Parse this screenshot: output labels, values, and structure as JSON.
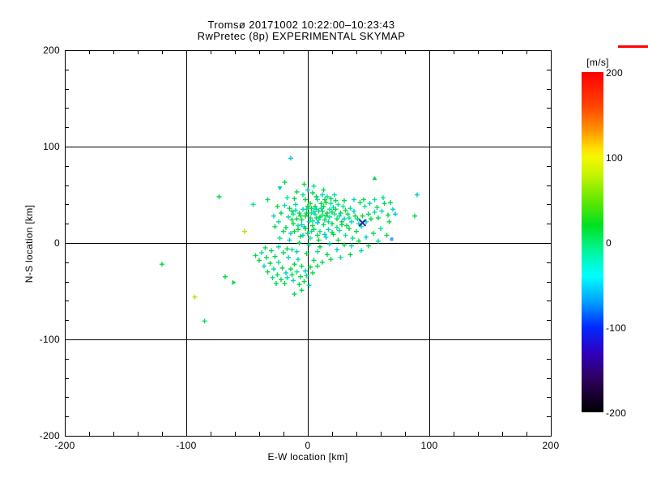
{
  "title": {
    "line1": "Tromsø 20171002 10:22:00–10:23:43",
    "line2": "RwPretec (8p) EXPERIMENTAL SKYMAP"
  },
  "chart_data": {
    "type": "scatter",
    "title": "Tromsø 20171002 10:22:00–10:23:43",
    "subtitle": "RwPretec (8p) EXPERIMENTAL SKYMAP",
    "xlabel": "E-W location [km]",
    "ylabel": "N-S location [km]",
    "xlim": [
      -200,
      200
    ],
    "ylim": [
      -200,
      200
    ],
    "xticks": [
      "-200",
      "-100",
      "0",
      "100",
      "200"
    ],
    "yticks": [
      "200",
      "100",
      "0",
      "-100",
      "-200"
    ],
    "xtick_values": [
      -200,
      -100,
      0,
      100,
      200
    ],
    "ytick_values": [
      200,
      100,
      0,
      -100,
      -200
    ],
    "gridlines_at": [
      -100,
      0,
      100
    ],
    "minor_tick_interval_km": 20,
    "grid": true,
    "legend_position": "none",
    "marker_default": "plus",
    "colorbar": {
      "label": "[m/s]",
      "lim": [
        -200,
        200
      ],
      "ticks": [
        "200",
        "100",
        "0",
        "-100",
        "-200"
      ],
      "tick_values": [
        200,
        100,
        0,
        -100,
        -200
      ],
      "colormap": "rainbow (red=+200, yellow=+100, green=0, cyan=-50, blue=-100, black=-200)"
    },
    "palette": [
      "#00d944",
      "#00e392",
      "#00d2bc",
      "#00c6e6",
      "#2ec232",
      "#b4e000",
      "#4a9aff",
      "#2525b0"
    ],
    "points": [
      [
        -2,
        28,
        0
      ],
      [
        3,
        31,
        1
      ],
      [
        7,
        26,
        0
      ],
      [
        1,
        22,
        2
      ],
      [
        9,
        33,
        0
      ],
      [
        12,
        29,
        1
      ],
      [
        -5,
        24,
        0
      ],
      [
        4,
        18,
        0
      ],
      [
        8,
        21,
        3
      ],
      [
        14,
        24,
        0
      ],
      [
        -1,
        35,
        1
      ],
      [
        6,
        38,
        0
      ],
      [
        11,
        36,
        2
      ],
      [
        2,
        41,
        0
      ],
      [
        -7,
        31,
        0
      ],
      [
        16,
        31,
        0
      ],
      [
        18,
        27,
        1
      ],
      [
        13,
        19,
        0
      ],
      [
        -3,
        17,
        2
      ],
      [
        5,
        14,
        0
      ],
      [
        10,
        12,
        1
      ],
      [
        0,
        10,
        0
      ],
      [
        -8,
        14,
        0
      ],
      [
        17,
        14,
        2
      ],
      [
        20,
        20,
        0
      ],
      [
        22,
        30,
        1
      ],
      [
        24,
        25,
        0
      ],
      [
        21,
        37,
        2
      ],
      [
        15,
        42,
        0
      ],
      [
        8,
        45,
        1
      ],
      [
        -2,
        45,
        0
      ],
      [
        -10,
        40,
        2
      ],
      [
        -13,
        33,
        0
      ],
      [
        -16,
        27,
        1
      ],
      [
        -12,
        20,
        0
      ],
      [
        -18,
        16,
        0
      ],
      [
        -14,
        10,
        2
      ],
      [
        -6,
        7,
        0
      ],
      [
        2,
        5,
        1
      ],
      [
        9,
        3,
        0
      ],
      [
        15,
        6,
        2
      ],
      [
        21,
        9,
        0
      ],
      [
        26,
        13,
        1
      ],
      [
        28,
        19,
        0
      ],
      [
        30,
        25,
        2
      ],
      [
        27,
        31,
        0
      ],
      [
        25,
        40,
        1
      ],
      [
        19,
        46,
        0
      ],
      [
        12,
        50,
        2
      ],
      [
        4,
        52,
        0
      ],
      [
        -4,
        50,
        1
      ],
      [
        -11,
        46,
        0
      ],
      [
        -19,
        39,
        2
      ],
      [
        -22,
        31,
        0
      ],
      [
        -24,
        22,
        1
      ],
      [
        -20,
        12,
        0
      ],
      [
        -15,
        3,
        2
      ],
      [
        -7,
        0,
        0
      ],
      [
        1,
        -2,
        1
      ],
      [
        10,
        -4,
        0
      ],
      [
        18,
        -1,
        2
      ],
      [
        25,
        3,
        0
      ],
      [
        31,
        8,
        1
      ],
      [
        34,
        15,
        0
      ],
      [
        36,
        22,
        2
      ],
      [
        33,
        30,
        0
      ],
      [
        29,
        38,
        1
      ],
      [
        23,
        44,
        0
      ],
      [
        16,
        48,
        1
      ],
      [
        7,
        48,
        0
      ],
      [
        0,
        55,
        2
      ],
      [
        -9,
        53,
        0
      ],
      [
        -17,
        47,
        1
      ],
      [
        -25,
        38,
        0
      ],
      [
        -28,
        28,
        2
      ],
      [
        -27,
        17,
        0
      ],
      [
        -23,
        5,
        1
      ],
      [
        -17,
        -6,
        0
      ],
      [
        -9,
        -9,
        2
      ],
      [
        -1,
        -11,
        0
      ],
      [
        8,
        -9,
        1
      ],
      [
        16,
        -12,
        0
      ],
      [
        24,
        -7,
        2
      ],
      [
        30,
        -2,
        0
      ],
      [
        37,
        5,
        1
      ],
      [
        40,
        12,
        0
      ],
      [
        42,
        20,
        2
      ],
      [
        39,
        28,
        0
      ],
      [
        35,
        36,
        1
      ],
      [
        30,
        44,
        0
      ],
      [
        22,
        50,
        2
      ],
      [
        13,
        55,
        0
      ],
      [
        5,
        59,
        1
      ],
      [
        -3,
        61,
        0
      ],
      [
        -33,
        45,
        0
      ],
      [
        3,
        36,
        0
      ],
      [
        6,
        30,
        2
      ],
      [
        9,
        24,
        1
      ],
      [
        12,
        33,
        0
      ],
      [
        15,
        28,
        0
      ],
      [
        18,
        35,
        1
      ],
      [
        11,
        41,
        0
      ],
      [
        7,
        35,
        2
      ],
      [
        2,
        26,
        0
      ],
      [
        -1,
        31,
        0
      ],
      [
        4,
        23,
        1
      ],
      [
        13,
        38,
        0
      ],
      [
        17,
        22,
        2
      ],
      [
        20,
        32,
        0
      ],
      [
        10,
        27,
        0
      ],
      [
        5,
        33,
        1
      ],
      [
        0,
        38,
        0
      ],
      [
        -4,
        35,
        2
      ],
      [
        -6,
        28,
        0
      ],
      [
        14,
        45,
        0
      ],
      [
        19,
        41,
        1
      ],
      [
        23,
        35,
        0
      ],
      [
        26,
        28,
        2
      ],
      [
        28,
        22,
        0
      ],
      [
        24,
        16,
        1
      ],
      [
        20,
        11,
        0
      ],
      [
        14,
        9,
        2
      ],
      [
        8,
        8,
        0
      ],
      [
        3,
        12,
        1
      ],
      [
        -2,
        15,
        0
      ],
      [
        -5,
        19,
        2
      ],
      [
        -9,
        25,
        0
      ],
      [
        -12,
        30,
        1
      ],
      [
        -15,
        36,
        0
      ],
      [
        -10,
        34,
        2
      ],
      [
        -13,
        24,
        0
      ],
      [
        -8,
        18,
        1
      ],
      [
        -11,
        12,
        0
      ],
      [
        -4,
        8,
        2
      ],
      [
        32,
        18,
        0
      ],
      [
        34,
        26,
        1
      ],
      [
        31,
        34,
        0
      ],
      [
        38,
        33,
        2
      ],
      [
        41,
        25,
        0
      ],
      [
        44,
        17,
        1
      ],
      [
        45,
        28,
        0
      ],
      [
        48,
        22,
        2
      ],
      [
        50,
        30,
        0
      ],
      [
        47,
        38,
        1
      ],
      [
        43,
        42,
        0
      ],
      [
        38,
        45,
        2
      ],
      [
        52,
        25,
        0
      ],
      [
        55,
        32,
        1
      ],
      [
        58,
        26,
        0
      ],
      [
        61,
        33,
        2
      ],
      [
        63,
        41,
        0
      ],
      [
        55,
        45,
        1
      ],
      [
        66,
        29,
        0
      ],
      [
        70,
        35,
        2
      ],
      [
        67,
        22,
        0
      ],
      [
        60,
        15,
        1
      ],
      [
        54,
        10,
        0
      ],
      [
        48,
        6,
        2
      ],
      [
        42,
        2,
        0
      ],
      [
        36,
        -3,
        1
      ],
      [
        46,
        45,
        0
      ],
      [
        51,
        41,
        2
      ],
      [
        57,
        37,
        0
      ],
      [
        62,
        47,
        1
      ],
      [
        68,
        42,
        0
      ],
      [
        72,
        30,
        3
      ],
      [
        65,
        8,
        0
      ],
      [
        58,
        2,
        1
      ],
      [
        50,
        -3,
        0
      ],
      [
        44,
        -8,
        2
      ],
      [
        35,
        -12,
        0
      ],
      [
        27,
        -15,
        1
      ],
      [
        19,
        -17,
        0
      ],
      [
        88,
        28,
        0
      ],
      [
        90,
        50,
        2
      ],
      [
        -30,
        -8,
        0
      ],
      [
        -27,
        -14,
        0
      ],
      [
        -24,
        -20,
        1
      ],
      [
        -21,
        -26,
        0
      ],
      [
        -18,
        -31,
        2
      ],
      [
        -14,
        -27,
        0
      ],
      [
        -11,
        -22,
        0
      ],
      [
        -8,
        -17,
        1
      ],
      [
        -5,
        -24,
        0
      ],
      [
        -2,
        -29,
        2
      ],
      [
        -34,
        -15,
        0
      ],
      [
        -31,
        -21,
        0
      ],
      [
        -28,
        -27,
        1
      ],
      [
        -25,
        -33,
        0
      ],
      [
        -22,
        -38,
        0
      ],
      [
        -17,
        -36,
        2
      ],
      [
        -13,
        -33,
        0
      ],
      [
        -9,
        -30,
        1
      ],
      [
        -6,
        -35,
        0
      ],
      [
        -3,
        -40,
        0
      ],
      [
        -36,
        -24,
        2
      ],
      [
        -33,
        -30,
        0
      ],
      [
        -29,
        -36,
        1
      ],
      [
        -26,
        -42,
        0
      ],
      [
        -19,
        -42,
        0
      ],
      [
        -12,
        -39,
        2
      ],
      [
        -7,
        -43,
        0
      ],
      [
        -1,
        -34,
        1
      ],
      [
        2,
        -25,
        0
      ],
      [
        5,
        -18,
        0
      ],
      [
        -38,
        -10,
        1
      ],
      [
        -35,
        -5,
        0
      ],
      [
        -40,
        -18,
        0
      ],
      [
        -16,
        -15,
        2
      ],
      [
        -20,
        -10,
        0
      ],
      [
        -13,
        -7,
        1
      ],
      [
        4,
        -31,
        0
      ],
      [
        8,
        -24,
        0
      ],
      [
        1,
        -44,
        2
      ],
      [
        -5,
        -49,
        0
      ],
      [
        12,
        -20,
        0
      ],
      [
        -24,
        -4,
        1
      ],
      [
        -14,
        88,
        3
      ],
      [
        -19,
        63,
        0
      ],
      [
        -23,
        57,
        2,
        "v"
      ],
      [
        -45,
        40,
        1
      ],
      [
        -73,
        48,
        0
      ],
      [
        55,
        67,
        0,
        "^"
      ],
      [
        -11,
        -53,
        0
      ],
      [
        -120,
        -22,
        0
      ],
      [
        -93,
        -56,
        5
      ],
      [
        -85,
        -81,
        0
      ],
      [
        -68,
        -35,
        0
      ],
      [
        -61,
        -41,
        0,
        ">"
      ],
      [
        -43,
        -13,
        0
      ],
      [
        -52,
        12,
        5
      ],
      [
        69,
        4,
        6,
        "s"
      ],
      [
        45,
        21,
        7,
        "x"
      ]
    ]
  },
  "axes": {
    "xlabel": "E-W location [km]",
    "ylabel": "N-S location [km]"
  },
  "colorbar": {
    "label": "[m/s]"
  }
}
